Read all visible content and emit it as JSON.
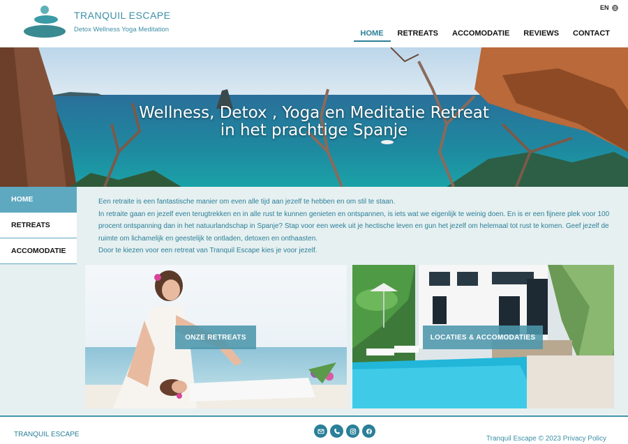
{
  "brand": {
    "title": "TRANQUIL ESCAPE",
    "subtitle": "Detox Wellness Yoga Meditation"
  },
  "language": {
    "label": "EN",
    "icon": "globe-icon"
  },
  "nav": {
    "items": [
      {
        "label": "HOME",
        "active": true
      },
      {
        "label": "RETREATS",
        "active": false
      },
      {
        "label": "ACCOMODATIE",
        "active": false
      },
      {
        "label": "REVIEWS",
        "active": false
      },
      {
        "label": "CONTACT",
        "active": false
      }
    ]
  },
  "hero": {
    "line1": "Wellness, Detox , Yoga en Meditatie Retreat",
    "line2": "in het prachtige Spanje"
  },
  "sidebar": {
    "items": [
      {
        "label": "HOME",
        "active": true
      },
      {
        "label": "RETREATS",
        "active": false
      },
      {
        "label": "ACCOMODATIE",
        "active": false
      }
    ]
  },
  "intro": {
    "p1": "Een retraite is een fantastische manier om even alle tijd aan jezelf te hebben en om stil te staan.",
    "p2": "In retraite gaan en jezelf even terugtrekken en in alle rust te kunnen genieten en ontspannen, is iets wat we eigenlijk te weinig doen. En is er een fijnere plek voor 100 procent ontspanning dan in het natuurlandschap in Spanje? Stap voor een week uit je hectische leven en gun het jezelf om helemaal tot rust te komen. Geef jezelf de ruimte om lichamelijk en geestelijk te ontladen, detoxen en onthaasten.",
    "p3": "Door te kiezen voor een retreat van Tranquil Escape kies je voor jezelf."
  },
  "cards": [
    {
      "button": "ONZE RETREATS"
    },
    {
      "button": "LOCATIES & ACCOMODATIES"
    }
  ],
  "footer": {
    "brand": "TRANQUIL ESCAPE",
    "socials": [
      "email-icon",
      "phone-icon",
      "instagram-icon",
      "facebook-icon"
    ],
    "copyright": "Tranquil Escape © 2023",
    "privacy": "Privacy Policy"
  },
  "colors": {
    "accent": "#2b7f98",
    "sidebar_active": "#5ea8c0",
    "content_bg": "#e6f0f0"
  }
}
